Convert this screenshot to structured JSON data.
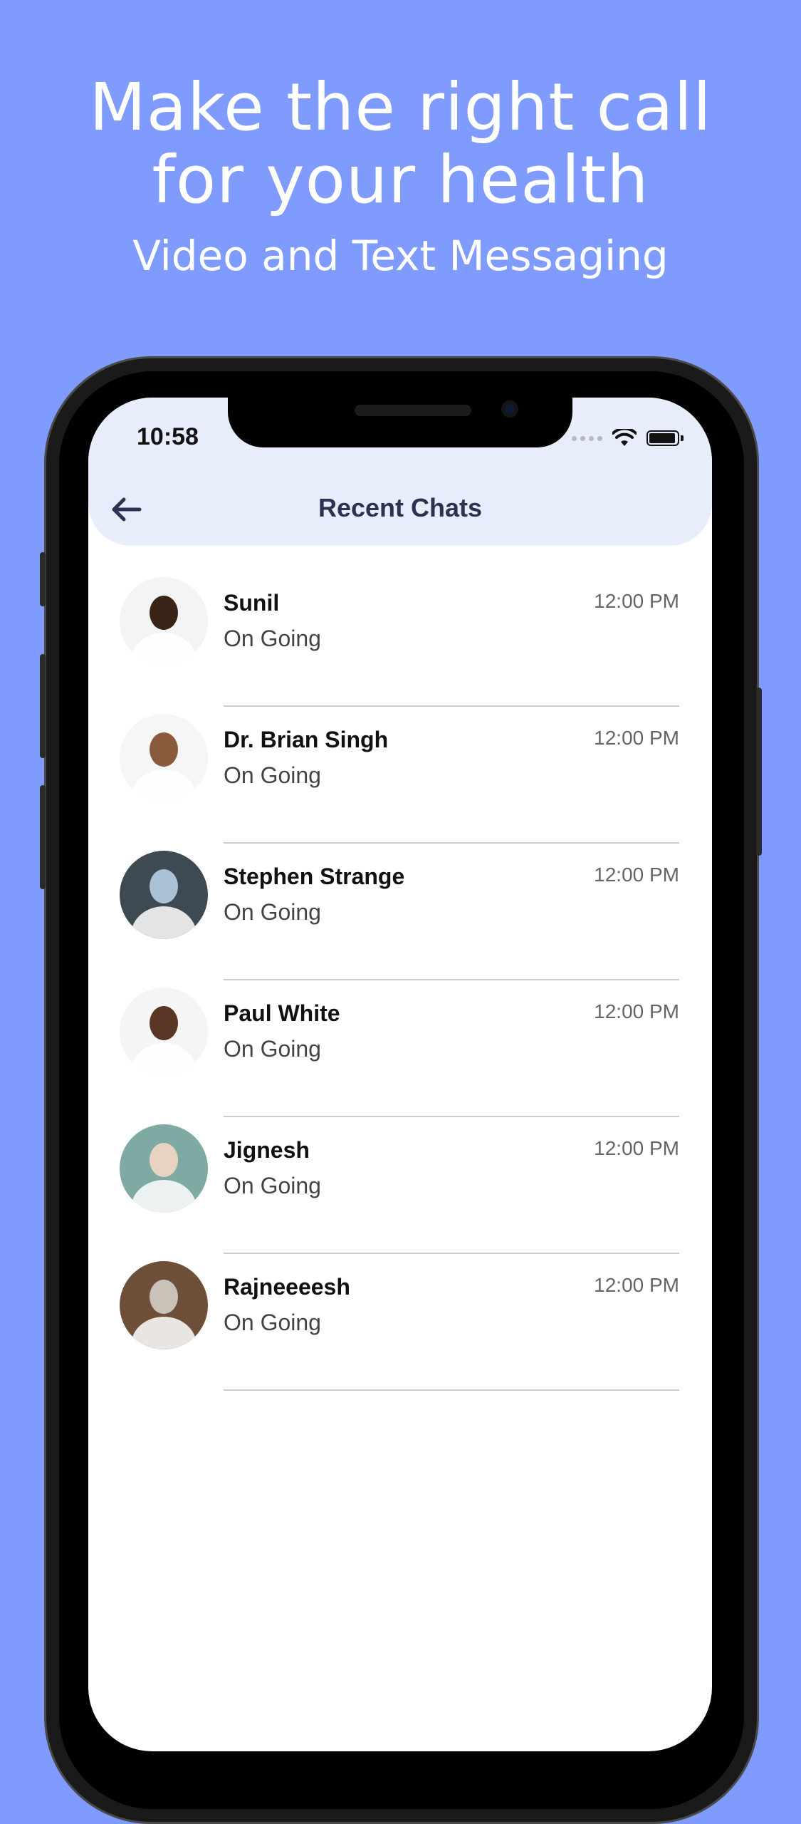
{
  "promo": {
    "headline_line1": "Make the right call",
    "headline_line2": "for your health",
    "subheadline": "Video and Text Messaging"
  },
  "status_bar": {
    "time": "10:58",
    "icons": [
      "cellular-dots-icon",
      "wifi-icon",
      "battery-icon"
    ]
  },
  "nav": {
    "back_icon": "arrow-left-icon",
    "title": "Recent Chats"
  },
  "chats": [
    {
      "name": "Sunil",
      "status": "On Going",
      "time": "12:00 PM",
      "avatar_bg": "#f4f4f4",
      "avatar_fg": "#3a2418"
    },
    {
      "name": "Dr. Brian Singh",
      "status": "On Going",
      "time": "12:00 PM",
      "avatar_bg": "#f6f6f6",
      "avatar_fg": "#8a5a3c"
    },
    {
      "name": "Stephen Strange",
      "status": "On Going",
      "time": "12:00 PM",
      "avatar_bg": "#3d4a52",
      "avatar_fg": "#a9c2d6"
    },
    {
      "name": "Paul White",
      "status": "On Going",
      "time": "12:00 PM",
      "avatar_bg": "#f5f5f5",
      "avatar_fg": "#5a3624"
    },
    {
      "name": "Jignesh",
      "status": "On Going",
      "time": "12:00 PM",
      "avatar_bg": "#7fa9a3",
      "avatar_fg": "#e8d2c0"
    },
    {
      "name": "Rajneeeesh",
      "status": "On Going",
      "time": "12:00 PM",
      "avatar_bg": "#6e4f3a",
      "avatar_fg": "#c9c2b8"
    }
  ],
  "colors": {
    "background": "#7f9bfd",
    "header": "#e8edfc",
    "title": "#2b3353"
  }
}
